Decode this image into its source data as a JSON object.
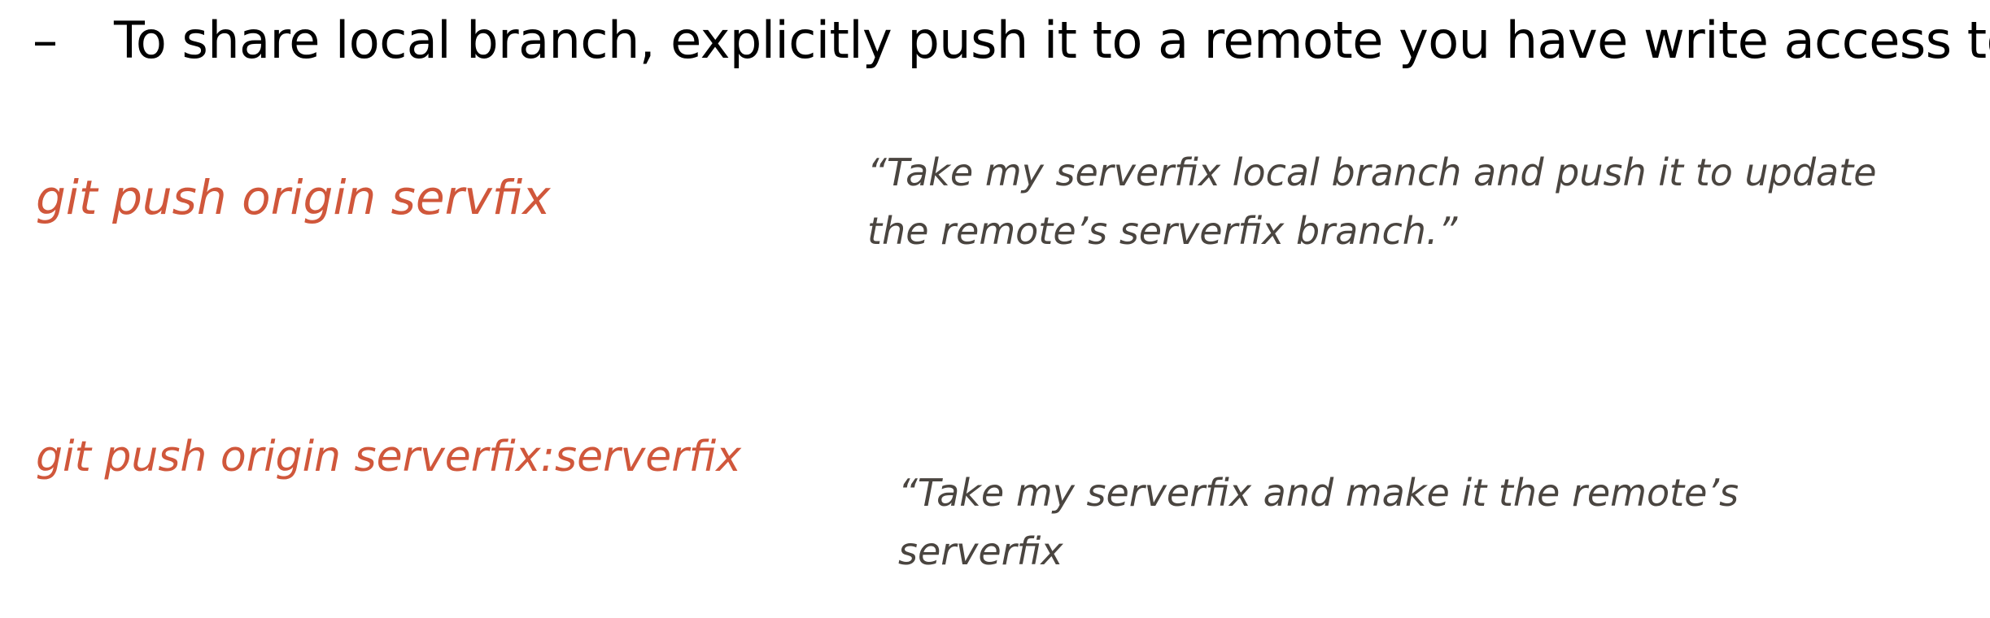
{
  "bullet": {
    "dash": "–",
    "text": "To share local branch, explicitly push it to a remote you have write access to"
  },
  "examples": [
    {
      "command": "git push origin servfix",
      "quote_lines": [
        "“Take my serverfix local branch and push it to update",
        "the remote’s serverfix branch.”"
      ]
    },
    {
      "command": "git push origin serverfix:serverfix",
      "quote_lines": [
        "“Take my serverfix and make it the remote’s",
        "serverfix"
      ]
    }
  ],
  "colors": {
    "command": "#d0573b",
    "quote": "#4a4540",
    "text": "#000000"
  }
}
